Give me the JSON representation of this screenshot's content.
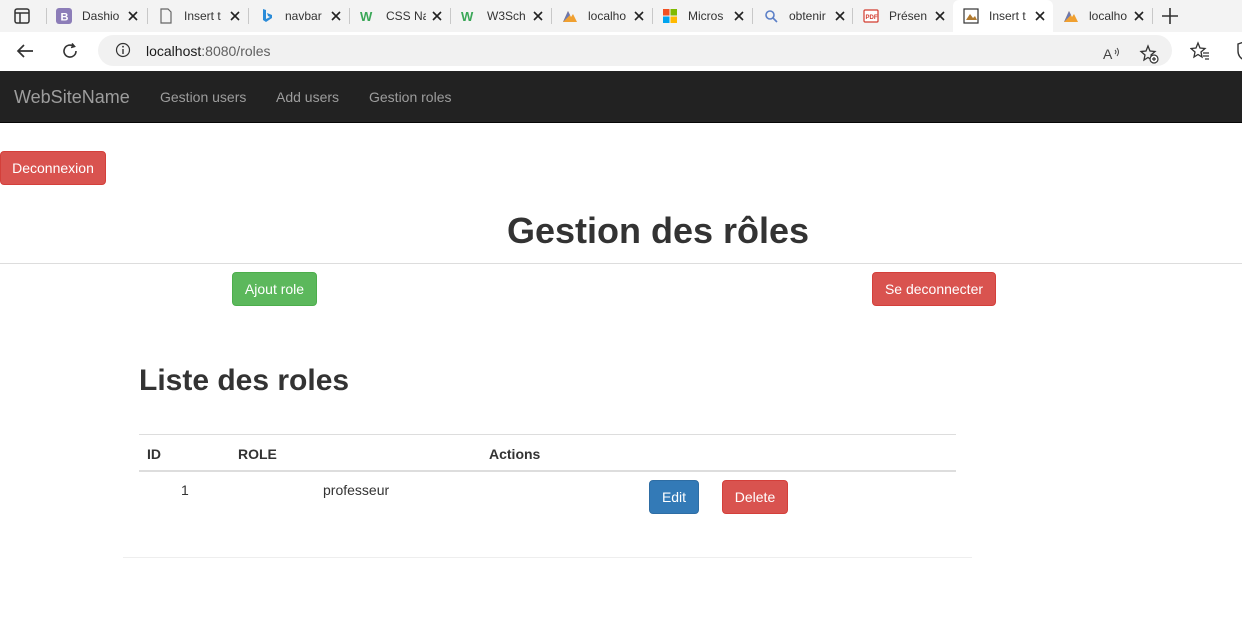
{
  "browser": {
    "tabs": [
      {
        "label": "Dashio",
        "favicon": "bootstrap-icon",
        "active": false
      },
      {
        "label": "Insert t",
        "favicon": "page-icon",
        "active": false
      },
      {
        "label": "navbar",
        "favicon": "bing-icon",
        "active": false
      },
      {
        "label": "CSS Na",
        "favicon": "w3schools-icon",
        "active": false
      },
      {
        "label": "W3Sch",
        "favicon": "w3schools-icon",
        "active": false
      },
      {
        "label": "localho",
        "favicon": "phpmyadmin-icon",
        "active": false
      },
      {
        "label": "Micros",
        "favicon": "microsoft-icon",
        "active": false
      },
      {
        "label": "obtenir",
        "favicon": "search-icon",
        "active": false
      },
      {
        "label": "Présen",
        "favicon": "pdf-icon",
        "active": false
      },
      {
        "label": "Insert t",
        "favicon": "image-icon",
        "active": true
      },
      {
        "label": "localho",
        "favicon": "phpmyadmin-icon",
        "active": false
      }
    ],
    "url_host": "localhost",
    "url_path": ":8080/roles"
  },
  "navbar": {
    "brand": "WebSiteName",
    "links": [
      "Gestion users",
      "Add users",
      "Gestion roles"
    ]
  },
  "page": {
    "logout_top": "Deconnexion",
    "title": "Gestion des rôles",
    "add_role": "Ajout role",
    "logout": "Se deconnecter",
    "list_title": "Liste des roles",
    "table": {
      "headers": [
        "ID",
        "ROLE",
        "Actions"
      ],
      "rows": [
        {
          "id": "1",
          "role": "professeur",
          "edit": "Edit",
          "delete": "Delete"
        }
      ]
    }
  },
  "colors": {
    "navbar_bg": "#222222",
    "danger": "#d9534f",
    "success": "#5cb85c",
    "primary": "#337ab7"
  }
}
